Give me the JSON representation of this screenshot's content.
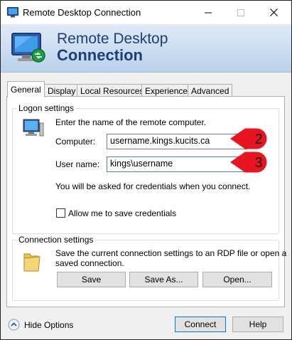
{
  "window": {
    "title": "Remote Desktop Connection"
  },
  "banner": {
    "line1": "Remote Desktop",
    "line2": "Connection"
  },
  "tabs": [
    {
      "label": "General"
    },
    {
      "label": "Display"
    },
    {
      "label": "Local Resources"
    },
    {
      "label": "Experience"
    },
    {
      "label": "Advanced"
    }
  ],
  "logon": {
    "group_label": "Logon settings",
    "instruction": "Enter the name of the remote computer.",
    "computer_label": "Computer:",
    "computer_value": "username.kings.kucits.ca",
    "username_label": "User name:",
    "username_value": "kings\\username",
    "credentials_note": "You will be asked for credentials when you connect.",
    "save_credentials_label": "Allow me to save credentials",
    "save_credentials_checked": false
  },
  "connection": {
    "group_label": "Connection settings",
    "description_line1": "Save the current connection settings to an RDP file or open a",
    "description_line2": "saved connection.",
    "save_label": "Save",
    "save_as_label": "Save As...",
    "open_label": "Open..."
  },
  "footer": {
    "hide_options_label": "Hide Options",
    "connect_label": "Connect",
    "help_label": "Help"
  },
  "annotations": [
    {
      "number": "2"
    },
    {
      "number": "3"
    }
  ],
  "colors": {
    "annotation_red": "#e8141f",
    "banner_text": "#1c3f7a",
    "focus_blue": "#0078d7"
  }
}
